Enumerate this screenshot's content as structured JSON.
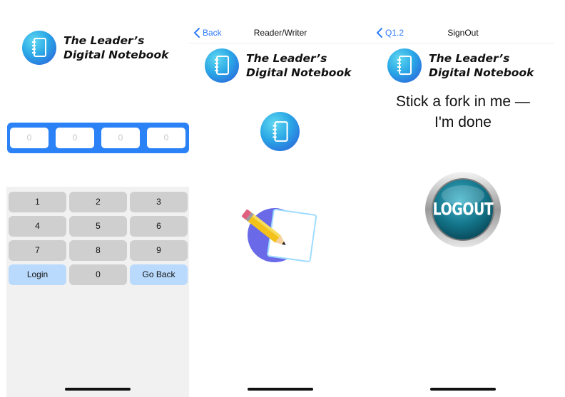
{
  "screen1": {
    "logo": {
      "line1": "The Leader’s",
      "line2": "Digital Notebook",
      "icon": "notebook-icon"
    },
    "pin_digits": [
      "0",
      "0",
      "0",
      "0"
    ],
    "keys": [
      "1",
      "2",
      "3",
      "4",
      "5",
      "6",
      "7",
      "8",
      "9",
      "Login",
      "0",
      "Go Back"
    ]
  },
  "screen2": {
    "nav": {
      "back_label": "Back",
      "title": "Reader/Writer"
    },
    "logo": {
      "line1": "The Leader’s",
      "line2": "Digital Notebook"
    },
    "notebook_button_icon": "notebook-icon",
    "writer_icon": "pencil-paper-icon"
  },
  "screen3": {
    "nav": {
      "back_label": "Q1.2",
      "title": "SignOut"
    },
    "logo": {
      "line1": "The Leader’s",
      "line2": "Digital Notebook"
    },
    "message_line1": "Stick a fork in me —",
    "message_line2": "I'm done",
    "logout_label": "LOGOUT"
  },
  "colors": {
    "accent_blue": "#2a82f6",
    "key_gray": "#cfcfcf",
    "key_accent": "#b9dafc",
    "link_blue": "#2f7cf6"
  }
}
